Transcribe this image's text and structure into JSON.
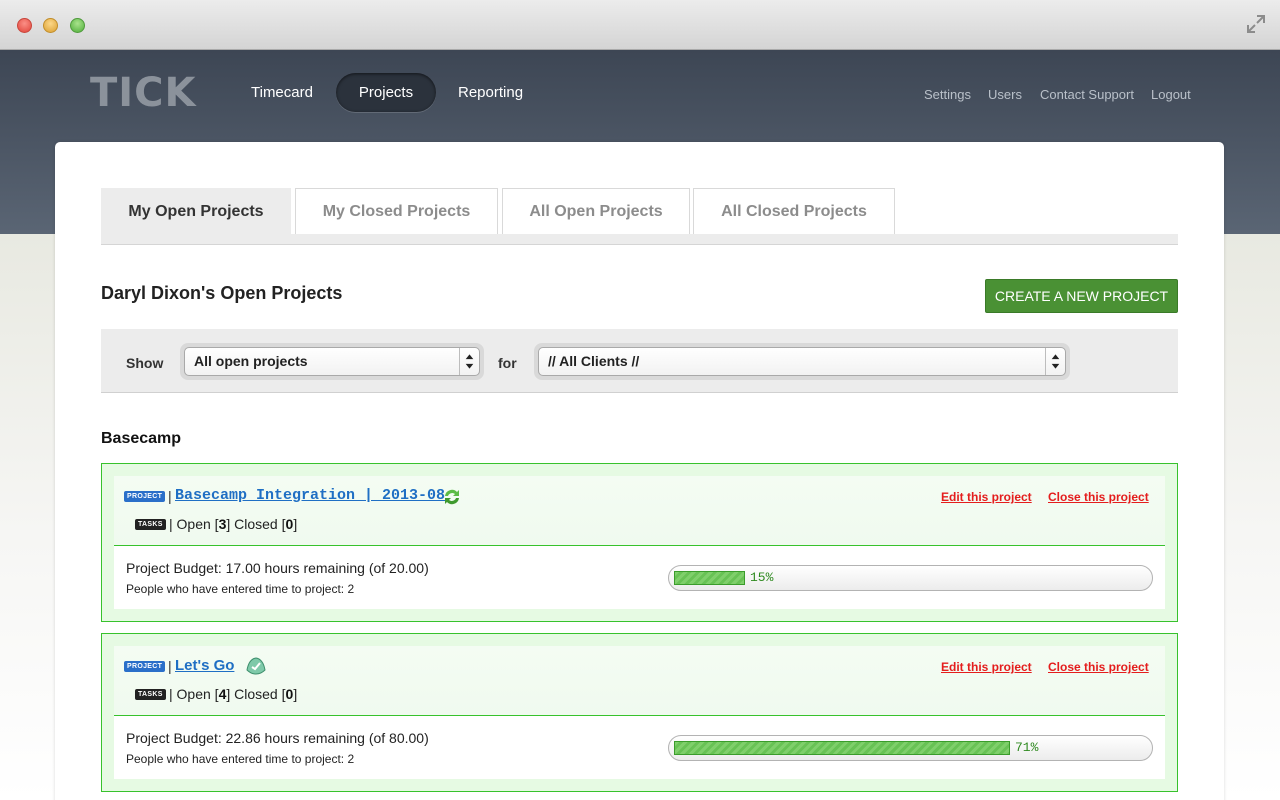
{
  "app": {
    "logo": "TICK"
  },
  "nav": {
    "items": [
      {
        "label": "Timecard",
        "active": false
      },
      {
        "label": "Projects",
        "active": true
      },
      {
        "label": "Reporting",
        "active": false
      }
    ],
    "right_links": [
      "Settings",
      "Users",
      "Contact Support",
      "Logout"
    ]
  },
  "tabs": [
    {
      "label": "My Open Projects",
      "active": true
    },
    {
      "label": "My Closed Projects",
      "active": false
    },
    {
      "label": "All Open Projects",
      "active": false
    },
    {
      "label": "All Closed Projects",
      "active": false
    }
  ],
  "page": {
    "heading": "Daryl Dixon's Open Projects",
    "create_button": "CREATE A NEW PROJECT"
  },
  "filters": {
    "show_label": "Show",
    "show_value": "All open projects",
    "for_label": "for",
    "client_value": "// All Clients //"
  },
  "group": {
    "title": "Basecamp",
    "projects": [
      {
        "project_badge": "PROJECT",
        "tasks_badge": "TASKS",
        "name": "Basecamp Integration | 2013-08",
        "icon": "sync-icon",
        "open_label": "Open",
        "open_count": "3",
        "closed_label": "Closed",
        "closed_count": "0",
        "edit_label": "Edit this project",
        "close_label": "Close this project",
        "budget_text": "Project Budget: 17.00 hours remaining (of 20.00)",
        "people_text": "People who have entered time to project: 2",
        "progress_pct": 15,
        "progress_label": "15%"
      },
      {
        "project_badge": "PROJECT",
        "tasks_badge": "TASKS",
        "name": "Let's Go",
        "icon": "basecamp-icon",
        "open_label": "Open",
        "open_count": "4",
        "closed_label": "Closed",
        "closed_count": "0",
        "edit_label": "Edit this project",
        "close_label": "Close this project",
        "budget_text": "Project Budget: 22.86 hours remaining (of 80.00)",
        "people_text": "People who have entered time to project: 2",
        "progress_pct": 71,
        "progress_label": "71%"
      }
    ]
  },
  "colors": {
    "brand_green": "#4a9134",
    "card_border": "#37c22c",
    "link_blue": "#1f6fc4",
    "action_red": "#e41d1d",
    "header_bg": "#3d4654"
  }
}
